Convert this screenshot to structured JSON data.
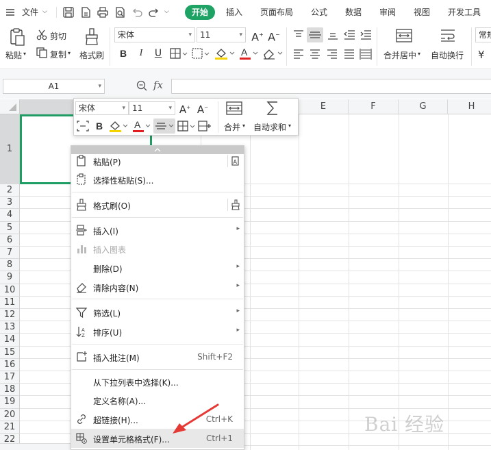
{
  "menubar": {
    "file_label": "文件",
    "tabs": [
      "开始",
      "插入",
      "页面布局",
      "公式",
      "数据",
      "审阅",
      "视图",
      "开发工具"
    ]
  },
  "ribbon": {
    "paste_label": "粘贴",
    "cut_label": "剪切",
    "copy_label": "复制",
    "format_painter_label": "格式刷",
    "font_name": "宋体",
    "font_size": "11",
    "merge_center_label": "合并居中",
    "wrap_text_label": "自动换行",
    "number_format": "常规"
  },
  "formula_bar": {
    "name_box": "A1",
    "fx_label": "fx",
    "formula": ""
  },
  "grid": {
    "columns": [
      "E",
      "F",
      "G",
      "H"
    ],
    "rows": [
      "1",
      "2",
      "3",
      "4",
      "5",
      "6",
      "7",
      "8",
      "9",
      "10",
      "11",
      "12",
      "13",
      "14",
      "15",
      "16",
      "17",
      "18",
      "19",
      "20",
      "21",
      "22"
    ],
    "selected_cell": "A1"
  },
  "mini_toolbar": {
    "font_name": "宋体",
    "font_size": "11",
    "merge_label": "合并",
    "autosum_label": "自动求和"
  },
  "context_menu": {
    "items": [
      {
        "label": "粘贴(P)",
        "icon": "paste-icon"
      },
      {
        "label": "选择性粘贴(S)...",
        "icon": "paste-special-icon"
      },
      {
        "label": "格式刷(O)",
        "icon": "format-painter-icon"
      },
      {
        "label": "插入(I)",
        "icon": "insert-icon"
      },
      {
        "label": "插入图表",
        "icon": "chart-icon"
      },
      {
        "label": "删除(D)",
        "icon": ""
      },
      {
        "label": "清除内容(N)",
        "icon": "eraser-icon"
      },
      {
        "label": "筛选(L)",
        "icon": "filter-icon"
      },
      {
        "label": "排序(U)",
        "icon": "sort-icon"
      },
      {
        "label": "插入批注(M)",
        "icon": "comment-icon",
        "shortcut": "Shift+F2"
      },
      {
        "label": "从下拉列表中选择(K)...",
        "icon": ""
      },
      {
        "label": "定义名称(A)...",
        "icon": ""
      },
      {
        "label": "超链接(H)...",
        "icon": "link-icon",
        "shortcut": "Ctrl+K"
      },
      {
        "label": "设置单元格格式(F)...",
        "icon": "format-cells-icon",
        "shortcut": "Ctrl+1"
      }
    ]
  },
  "colors": {
    "accent_green": "#1ea365",
    "selection_border": "#1e9e64",
    "arrow_red": "#e53935",
    "font_color_red": "#e02020",
    "highlight_yellow": "#f5d300"
  }
}
